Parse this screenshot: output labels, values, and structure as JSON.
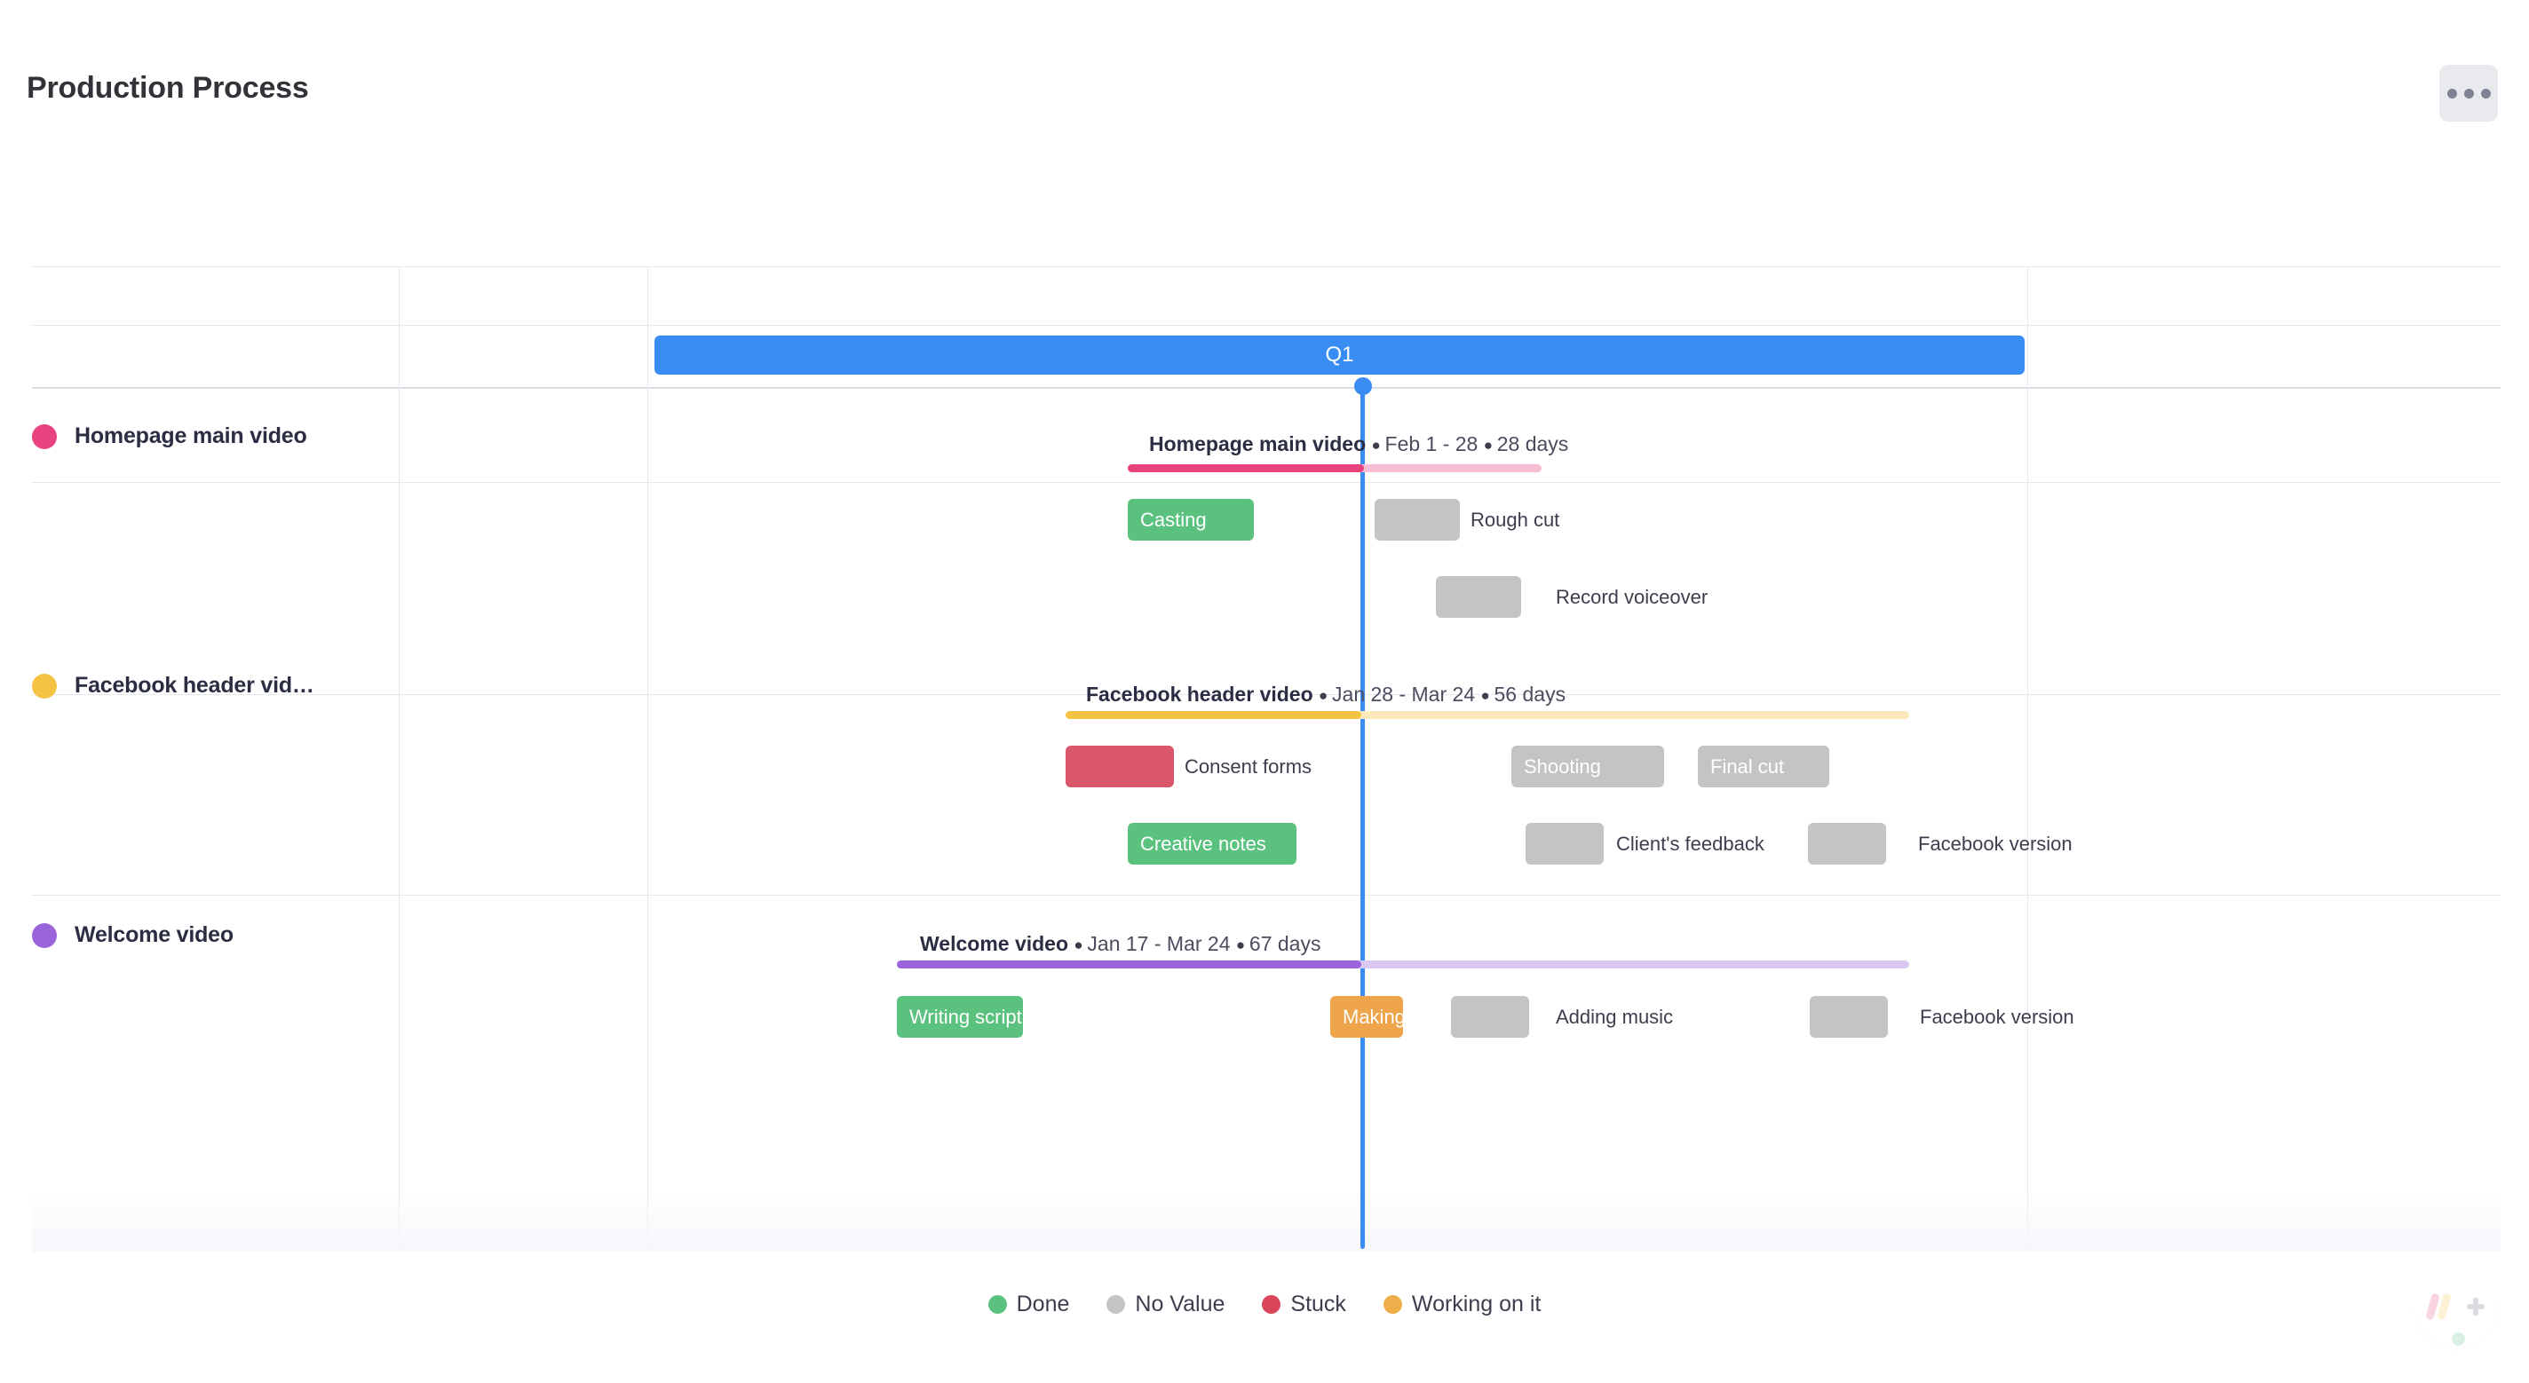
{
  "header": {
    "title": "Production Process",
    "menu_icon": "more-options-icon"
  },
  "timeline": {
    "quarter_label": "Q1",
    "today_marker": "today-line"
  },
  "legend": {
    "items": [
      {
        "label": "Done",
        "color": "#5bc17f"
      },
      {
        "label": "No Value",
        "color": "#c4c4c4"
      },
      {
        "label": "Stuck",
        "color": "#d9455b"
      },
      {
        "label": "Working on it",
        "color": "#f0ae4b"
      }
    ]
  },
  "groups": [
    {
      "name": "Homepage main video",
      "name_truncated": "Homepage main video",
      "color": "#e8437f",
      "progress_track_color": "#f7bdd4",
      "summary_name": "Homepage main video",
      "summary_dates": "Feb 1 - 28",
      "summary_duration": "28 days",
      "progress_percent": 57,
      "tasks": [
        {
          "label": "Casting",
          "status": "Done",
          "color": "#5bc17f",
          "label_inside": true
        },
        {
          "label": "Rough cut",
          "status": "No Value",
          "color": "#c4c4c4",
          "label_inside": false
        },
        {
          "label": "Record voiceover",
          "status": "No Value",
          "color": "#c4c4c4",
          "label_inside": false
        }
      ]
    },
    {
      "name": "Facebook header video",
      "name_truncated": "Facebook header vid…",
      "color": "#f5c343",
      "progress_track_color": "#fbe9bb",
      "summary_name": "Facebook header video",
      "summary_dates": "Jan 28 - Mar 24",
      "summary_duration": "56 days",
      "progress_percent": 35,
      "tasks": [
        {
          "label": "Consent forms",
          "status": "Stuck",
          "color": "#d9566b",
          "label_inside": false
        },
        {
          "label": "Shooting",
          "status": "No Value",
          "color": "#c4c4c4",
          "label_inside": true
        },
        {
          "label": "Final cut",
          "status": "No Value",
          "color": "#c4c4c4",
          "label_inside": true
        },
        {
          "label": "Creative notes",
          "status": "Done",
          "color": "#5bc17f",
          "label_inside": true
        },
        {
          "label": "Client's feedback",
          "status": "No Value",
          "color": "#c4c4c4",
          "label_inside": false
        },
        {
          "label": "Facebook version",
          "status": "No Value",
          "color": "#c4c4c4",
          "label_inside": false
        }
      ]
    },
    {
      "name": "Welcome video",
      "name_truncated": "Welcome video",
      "color": "#9a64da",
      "progress_track_color": "#d9c9f2",
      "summary_name": "Welcome video",
      "summary_dates": "Jan 17 - Mar 24",
      "summary_duration": "67 days",
      "progress_percent": 46,
      "tasks": [
        {
          "label": "Writing script",
          "status": "Done",
          "color": "#5bc17f",
          "label_inside": true
        },
        {
          "label": "Making",
          "status": "Working on it",
          "color": "#eda44a",
          "label_inside": true
        },
        {
          "label": "Adding music",
          "status": "No Value",
          "color": "#c4c4c4",
          "label_inside": false
        },
        {
          "label": "Facebook version",
          "status": "No Value",
          "color": "#c4c4c4",
          "label_inside": false
        }
      ]
    }
  ]
}
